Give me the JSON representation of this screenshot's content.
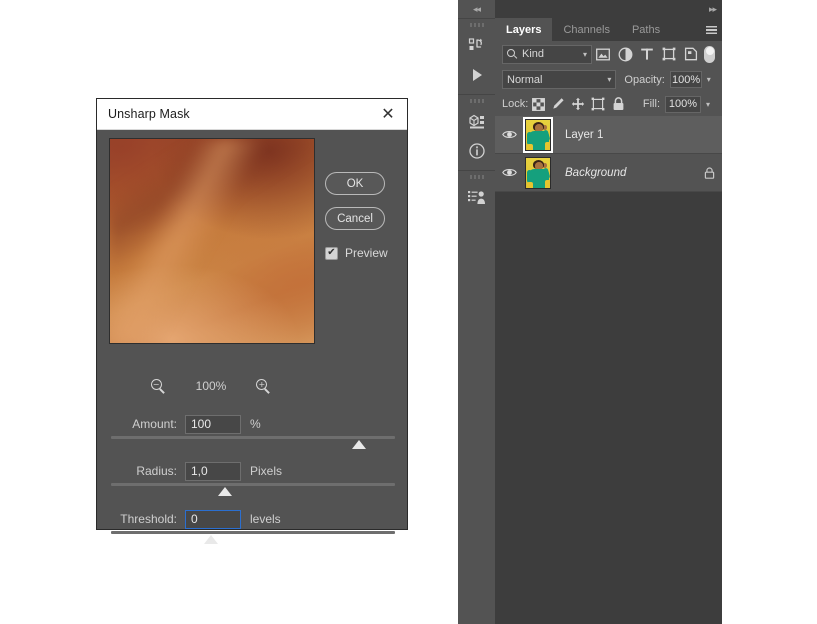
{
  "dialog": {
    "title": "Unsharp Mask",
    "close_label": "✕",
    "buttons": {
      "ok": "OK",
      "cancel": "Cancel"
    },
    "preview": {
      "label": "Preview",
      "checked": true,
      "check_glyph": "✔"
    },
    "zoom": {
      "level": "100%",
      "zoom_out_sign": "−",
      "zoom_in_sign": "+"
    },
    "params": [
      {
        "label": "Amount:",
        "value": "100",
        "unit": "%",
        "focused": false
      },
      {
        "label": "Radius:",
        "value": "1,0",
        "unit": "Pixels",
        "focused": false
      },
      {
        "label": "Threshold:",
        "value": "0",
        "unit": "levels",
        "focused": true
      }
    ]
  },
  "dock": {
    "rail": {
      "collapse_glyph": "◂◂",
      "icons": [
        {
          "name": "history-icon"
        },
        {
          "name": "actions-play-icon"
        },
        {
          "name": "3d-icon"
        },
        {
          "name": "info-icon"
        },
        {
          "name": "clone-source-icon"
        }
      ]
    },
    "panel": {
      "expand_glyph": "▸▸",
      "tabs": [
        {
          "label": "Layers",
          "active": true
        },
        {
          "label": "Channels",
          "active": false
        },
        {
          "label": "Paths",
          "active": false
        }
      ],
      "filter": {
        "kind_label": "Kind",
        "icons": [
          "pixel-layer-filter-icon",
          "adjustment-layer-filter-icon",
          "type-layer-filter-icon",
          "shape-layer-filter-icon",
          "smart-object-filter-icon"
        ],
        "toggle_on": true
      },
      "blend": {
        "mode": "Normal",
        "opacity_label": "Opacity:",
        "opacity_value": "100%",
        "fill_label": "Fill:",
        "fill_value": "100%"
      },
      "lock": {
        "label": "Lock:",
        "icons": [
          "lock-transparent-pixels-icon",
          "lock-image-pixels-icon",
          "lock-position-icon",
          "lock-artboard-nesting-icon",
          "lock-all-icon"
        ]
      },
      "layers": [
        {
          "name": "Layer 1",
          "visible": true,
          "selected": true,
          "italic": false,
          "locked": false
        },
        {
          "name": "Background",
          "visible": true,
          "selected": false,
          "italic": true,
          "locked": true
        }
      ]
    }
  },
  "colors": {
    "panel_bg": "#535353",
    "dock_bg": "#3d3d3d",
    "dialog_bg": "#535353",
    "titlebar_bg": "#ffffff",
    "focus_blue": "#2b6fd0",
    "text_light": "#d9d9d9",
    "accent_preview": "#c57a3c"
  }
}
